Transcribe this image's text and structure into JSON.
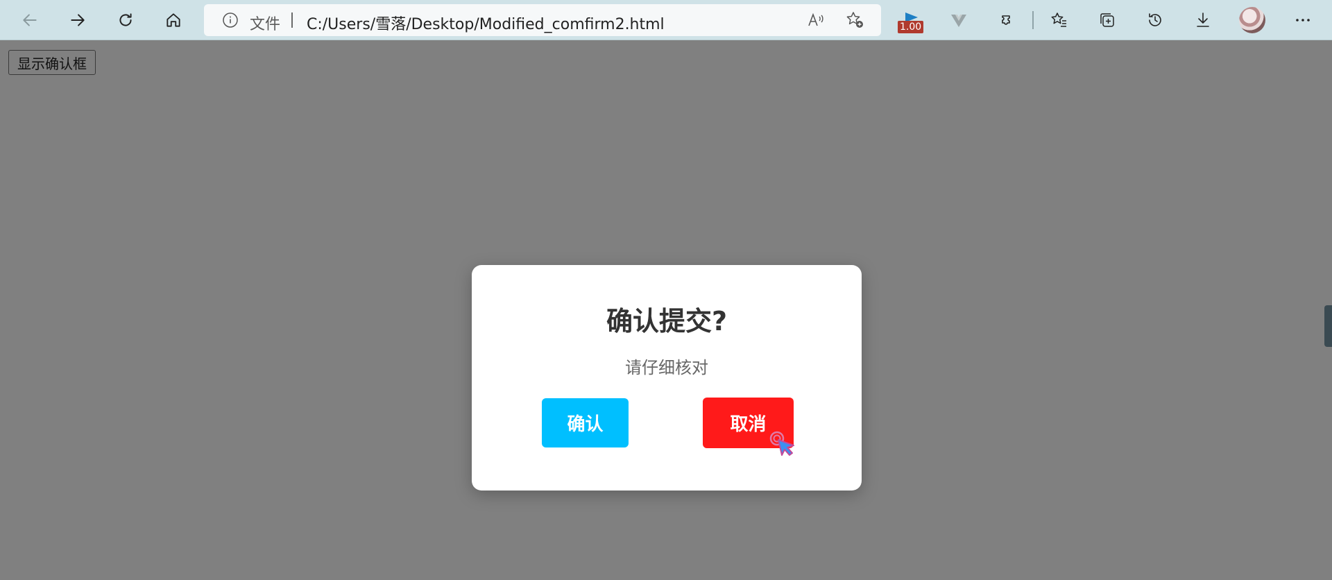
{
  "browser": {
    "address": {
      "label": "文件",
      "url": "C:/Users/雪落/Desktop/Modified_comfirm2.html"
    },
    "extension_badge": "1.00"
  },
  "page": {
    "show_button_label": "显示确认框"
  },
  "dialog": {
    "title": "确认提交?",
    "message": "请仔细核对",
    "confirm_label": "确认",
    "cancel_label": "取消"
  },
  "colors": {
    "overlay": "#808080",
    "confirm": "#00bfff",
    "cancel": "#ff1a1a",
    "toolbar": "#cfe2e7"
  }
}
